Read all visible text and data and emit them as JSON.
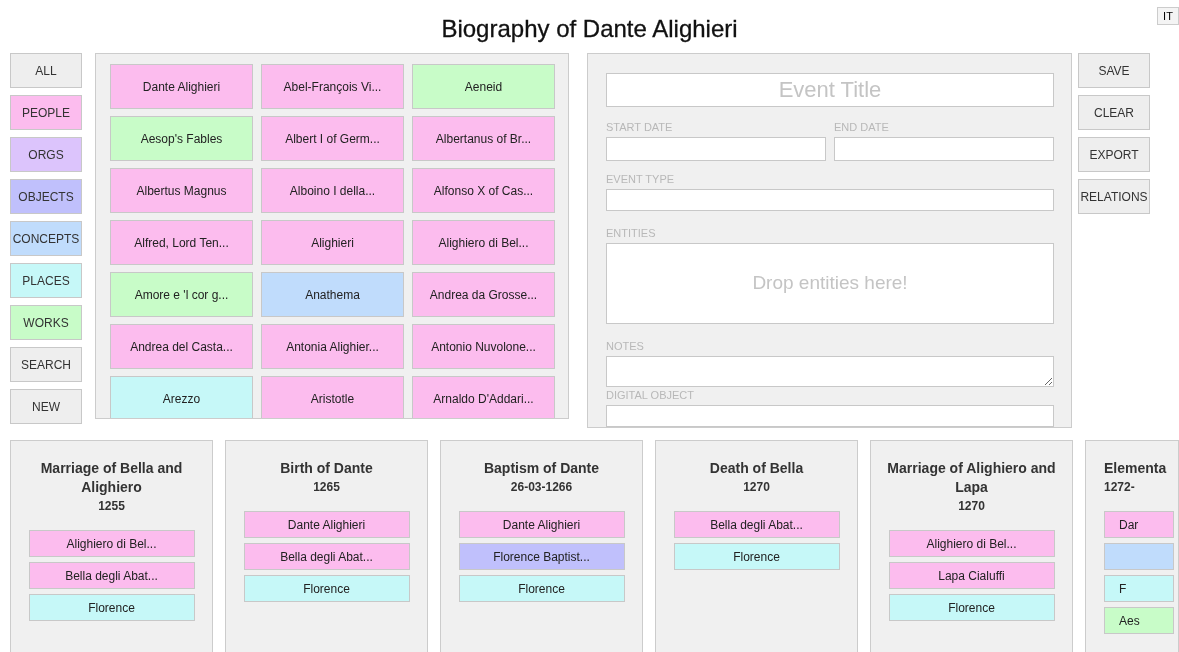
{
  "title": "Biography of Dante Alighieri",
  "language_button": "IT",
  "filters": [
    {
      "label": "ALL",
      "color": "#eeeeee"
    },
    {
      "label": "PEOPLE",
      "color": "#fcbcee"
    },
    {
      "label": "ORGS",
      "color": "#dcc4fc"
    },
    {
      "label": "OBJECTS",
      "color": "#c0c0fc"
    },
    {
      "label": "CONCEPTS",
      "color": "#c0dcfc"
    },
    {
      "label": "PLACES",
      "color": "#c6f8f8"
    },
    {
      "label": "WORKS",
      "color": "#c8fcc8"
    },
    {
      "label": "SEARCH",
      "color": "#eeeeee"
    },
    {
      "label": "NEW",
      "color": "#eeeeee"
    }
  ],
  "entities": [
    {
      "label": "Dante Alighieri",
      "color": "#fcbcee"
    },
    {
      "label": "Abel-François Vi...",
      "color": "#fcbcee"
    },
    {
      "label": "Aeneid",
      "color": "#c8fcc8"
    },
    {
      "label": "Aesop's Fables",
      "color": "#c8fcc8"
    },
    {
      "label": "Albert I of Germ...",
      "color": "#fcbcee"
    },
    {
      "label": "Albertanus of Br...",
      "color": "#fcbcee"
    },
    {
      "label": "Albertus Magnus",
      "color": "#fcbcee"
    },
    {
      "label": "Alboino I della...",
      "color": "#fcbcee"
    },
    {
      "label": "Alfonso X of Cas...",
      "color": "#fcbcee"
    },
    {
      "label": "Alfred, Lord Ten...",
      "color": "#fcbcee"
    },
    {
      "label": "Alighieri",
      "color": "#fcbcee"
    },
    {
      "label": "Alighiero di Bel...",
      "color": "#fcbcee"
    },
    {
      "label": "Amore e 'l cor g...",
      "color": "#c8fcc8"
    },
    {
      "label": "Anathema",
      "color": "#c0dcfc"
    },
    {
      "label": "Andrea da Grosse...",
      "color": "#fcbcee"
    },
    {
      "label": "Andrea del Casta...",
      "color": "#fcbcee"
    },
    {
      "label": "Antonia Alighier...",
      "color": "#fcbcee"
    },
    {
      "label": "Antonio Nuvolone...",
      "color": "#fcbcee"
    },
    {
      "label": "Arezzo",
      "color": "#c6f8f8"
    },
    {
      "label": "Aristotle",
      "color": "#fcbcee"
    },
    {
      "label": "Arnaldo D'Addari...",
      "color": "#fcbcee"
    }
  ],
  "form": {
    "title_placeholder": "Event Title",
    "start_date_label": "START DATE",
    "end_date_label": "END DATE",
    "event_type_label": "EVENT TYPE",
    "entities_label": "ENTITIES",
    "entities_placeholder": "Drop entities here!",
    "notes_label": "NOTES",
    "digital_object_label": "DIGITAL OBJECT"
  },
  "actions": [
    "SAVE",
    "CLEAR",
    "EXPORT",
    "RELATIONS"
  ],
  "events": [
    {
      "title": "Marriage of Bella and Alighiero",
      "date": "1255",
      "clipped": false,
      "entities": [
        {
          "label": "Alighiero di Bel...",
          "color": "#fcbcee"
        },
        {
          "label": "Bella degli Abat...",
          "color": "#fcbcee"
        },
        {
          "label": "Florence",
          "color": "#c6f8f8"
        }
      ]
    },
    {
      "title": "Birth of Dante",
      "date": "1265",
      "clipped": false,
      "entities": [
        {
          "label": "Dante Alighieri",
          "color": "#fcbcee"
        },
        {
          "label": "Bella degli Abat...",
          "color": "#fcbcee"
        },
        {
          "label": "Florence",
          "color": "#c6f8f8"
        }
      ]
    },
    {
      "title": "Baptism of Dante",
      "date": "26-03-1266",
      "clipped": false,
      "entities": [
        {
          "label": "Dante Alighieri",
          "color": "#fcbcee"
        },
        {
          "label": "Florence Baptist...",
          "color": "#c0c0fc"
        },
        {
          "label": "Florence",
          "color": "#c6f8f8"
        }
      ]
    },
    {
      "title": "Death of Bella",
      "date": "1270",
      "clipped": false,
      "entities": [
        {
          "label": "Bella degli Abat...",
          "color": "#fcbcee"
        },
        {
          "label": "Florence",
          "color": "#c6f8f8"
        }
      ]
    },
    {
      "title": "Marriage of Alighiero and Lapa",
      "date": "1270",
      "clipped": false,
      "entities": [
        {
          "label": "Alighiero di Bel...",
          "color": "#fcbcee"
        },
        {
          "label": "Lapa Cialuffi",
          "color": "#fcbcee"
        },
        {
          "label": "Florence",
          "color": "#c6f8f8"
        }
      ]
    },
    {
      "title": "Elementa",
      "date": "1272-",
      "clipped": true,
      "entities": [
        {
          "label": "Dar",
          "color": "#fcbcee"
        },
        {
          "color": "#c0dcfc"
        },
        {
          "label": "F",
          "color": "#c6f8f8"
        },
        {
          "label": "Aes",
          "color": "#c8fcc8"
        }
      ]
    }
  ]
}
